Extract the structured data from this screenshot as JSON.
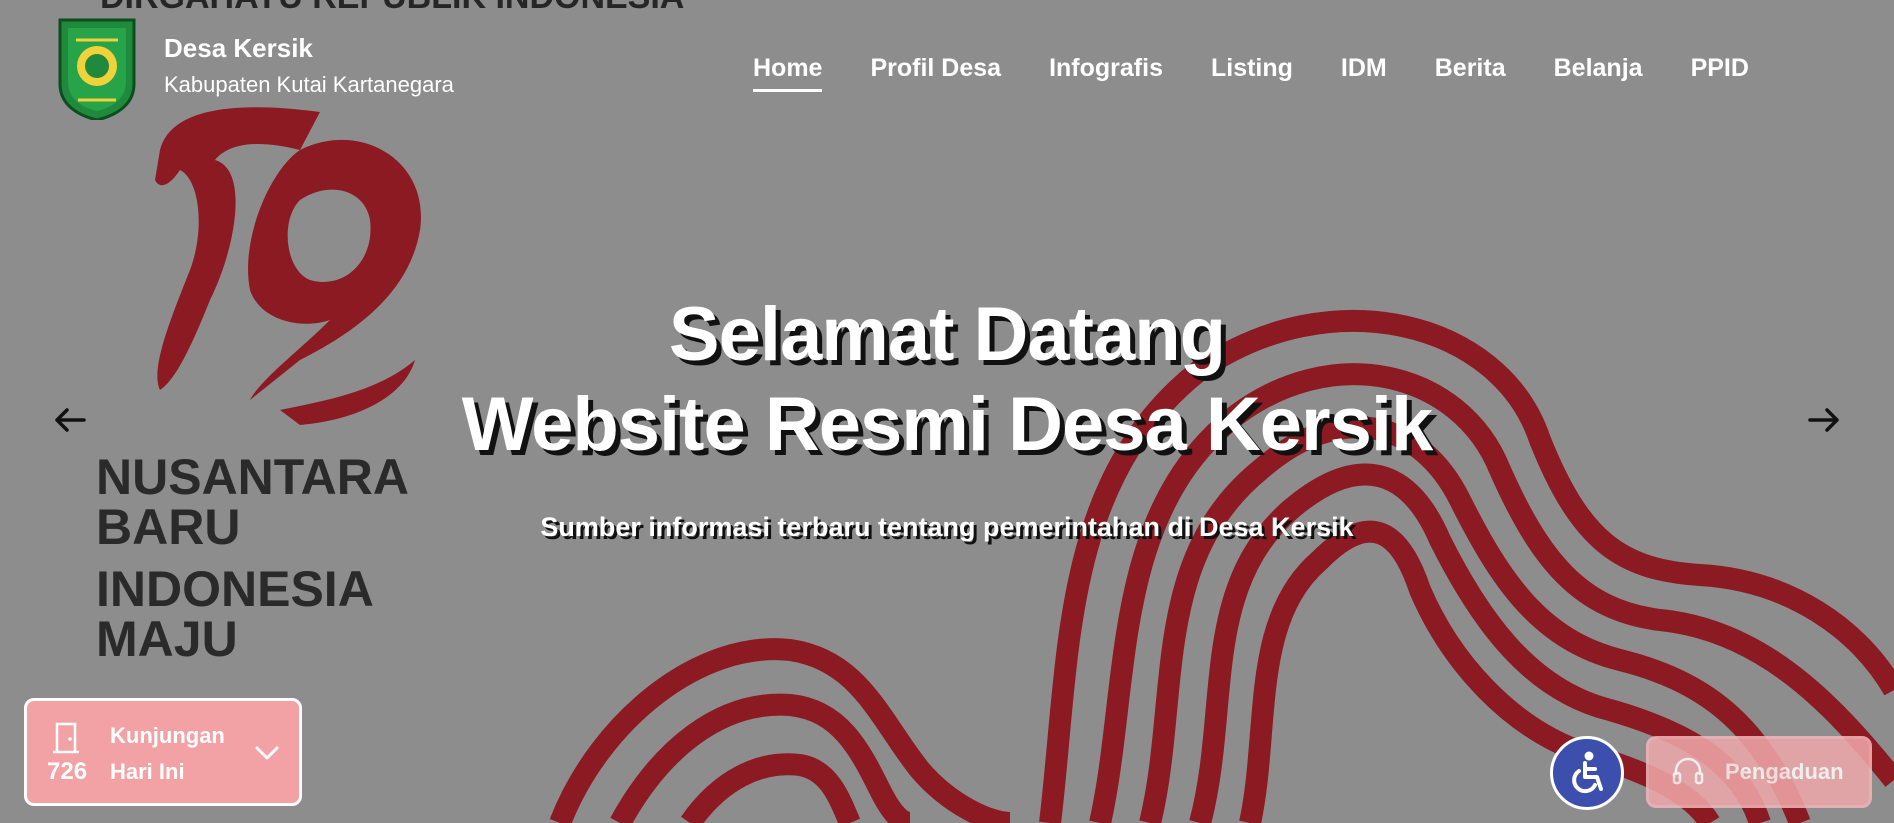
{
  "background": {
    "banner_top": "DIRGAHAYU REPUBLIK INDONESIA",
    "banner_lines": [
      "NUSANTARA",
      "BARU",
      "INDONESIA",
      "MAJU"
    ],
    "accent_red": "#8b1a22",
    "overlay_gray": "#8d8d8d"
  },
  "brand": {
    "title": "Desa Kersik",
    "subtitle": "Kabupaten Kutai Kartanegara",
    "logo_icon": "regency-crest-icon"
  },
  "nav": {
    "items": [
      {
        "label": "Home",
        "active": true
      },
      {
        "label": "Profil Desa",
        "active": false
      },
      {
        "label": "Infografis",
        "active": false
      },
      {
        "label": "Listing",
        "active": false
      },
      {
        "label": "IDM",
        "active": false
      },
      {
        "label": "Berita",
        "active": false
      },
      {
        "label": "Belanja",
        "active": false
      },
      {
        "label": "PPID",
        "active": false
      }
    ]
  },
  "hero": {
    "line1": "Selamat Datang",
    "line2": "Website Resmi Desa Kersik",
    "subtitle": "Sumber informasi terbaru tentang pemerintahan di Desa Kersik"
  },
  "carousel": {
    "prev_icon": "arrow-left-icon",
    "next_icon": "arrow-right-icon"
  },
  "visits": {
    "count": "726",
    "label_line1": "Kunjungan",
    "label_line2": "Hari Ini",
    "icon": "door-icon",
    "bg_color": "#f2a2a4"
  },
  "accessibility": {
    "icon": "wheelchair-icon",
    "color": "#3d4fad"
  },
  "complaint": {
    "label": "Pengaduan",
    "icon": "headset-icon"
  }
}
